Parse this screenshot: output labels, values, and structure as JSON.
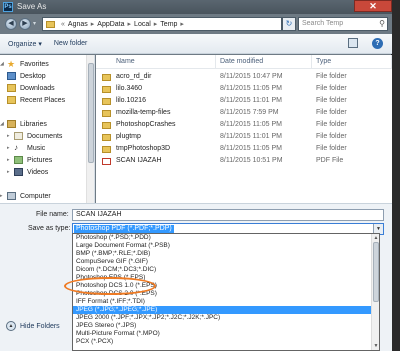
{
  "window": {
    "title": "Save As",
    "logo_text": "Ps",
    "close_glyph": "✕"
  },
  "address": {
    "breadcrumbs": [
      "Agnas",
      "AppData",
      "Local",
      "Temp"
    ],
    "separator": "▸",
    "lead_separator": "«",
    "search_placeholder": "Search Temp",
    "refresh_glyph": "↻",
    "search_glyph": "⚲"
  },
  "toolbar": {
    "organize_label": "Organize ▾",
    "new_folder_label": "New folder",
    "help_glyph": "?"
  },
  "nav": {
    "back_glyph": "◀",
    "forward_glyph": "▶",
    "dropdown_glyph": "▾",
    "favorites": "Favorites",
    "items_fav": [
      "Desktop",
      "Downloads",
      "Recent Places"
    ],
    "libraries": "Libraries",
    "items_lib": [
      "Documents",
      "Music",
      "Pictures",
      "Videos"
    ],
    "computer": "Computer",
    "expand_glyph": "▸",
    "collapse_glyph": "◢",
    "star_glyph": "★",
    "music_glyph": "♪"
  },
  "columns": {
    "name": "Name",
    "date": "Date modified",
    "type": "Type"
  },
  "files": [
    {
      "name": "acro_rd_dir",
      "date": "8/11/2015 10:47 PM",
      "type": "File folder"
    },
    {
      "name": "lilo.3460",
      "date": "8/11/2015 11:05 PM",
      "type": "File folder"
    },
    {
      "name": "lilo.10216",
      "date": "8/11/2015 11:01 PM",
      "type": "File folder"
    },
    {
      "name": "mozilla-temp-files",
      "date": "8/11/2015 7:59 PM",
      "type": "File folder"
    },
    {
      "name": "PhotoshopCrashes",
      "date": "8/11/2015 11:05 PM",
      "type": "File folder"
    },
    {
      "name": "plugtmp",
      "date": "8/11/2015 11:01 PM",
      "type": "File folder"
    },
    {
      "name": "tmpPhotoshop3D",
      "date": "8/11/2015 11:05 PM",
      "type": "File folder"
    },
    {
      "name": "SCAN IJAZAH",
      "date": "8/11/2015 10:51 PM",
      "type": "PDF File"
    }
  ],
  "form": {
    "filename_label": "File name:",
    "filename_value": "SCAN IJAZAH",
    "savetype_label": "Save as type:",
    "savetype_value": "Photoshop PDF (*.PDF;*.PDP)",
    "hide_folders_label": "Hide Folders",
    "select_arrow": "▼",
    "hide_glyph": "▲"
  },
  "dropdown": {
    "options": [
      "Photoshop (*.PSD;*.PDD)",
      "Large Document Format (*.PSB)",
      "BMP (*.BMP;*.RLE;*.DIB)",
      "CompuServe GIF (*.GIF)",
      "Dicom (*.DCM;*.DC3;*.DIC)",
      "Photoshop EPS (*.EPS)",
      "Photoshop DCS 1.0 (*.EPS)",
      "Photoshop DCS 2.0 (*.EPS)",
      "IFF Format (*.IFF;*.TDI)",
      "JPEG (*.JPG;*.JPEG;*.JPE)",
      "JPEG 2000 (*.JPF;*.JPX;*.JP2;*.J2C;*.J2K;*.JPC)",
      "JPEG Stereo (*.JPS)",
      "Multi-Picture Format (*.MPO)",
      "PCX (*.PCX)"
    ],
    "selected_index": 9,
    "up_glyph": "▲",
    "down_glyph": "▼"
  },
  "colors": {
    "highlight": "#ef7a22",
    "selection": "#3399ff",
    "close": "#c9483a"
  }
}
